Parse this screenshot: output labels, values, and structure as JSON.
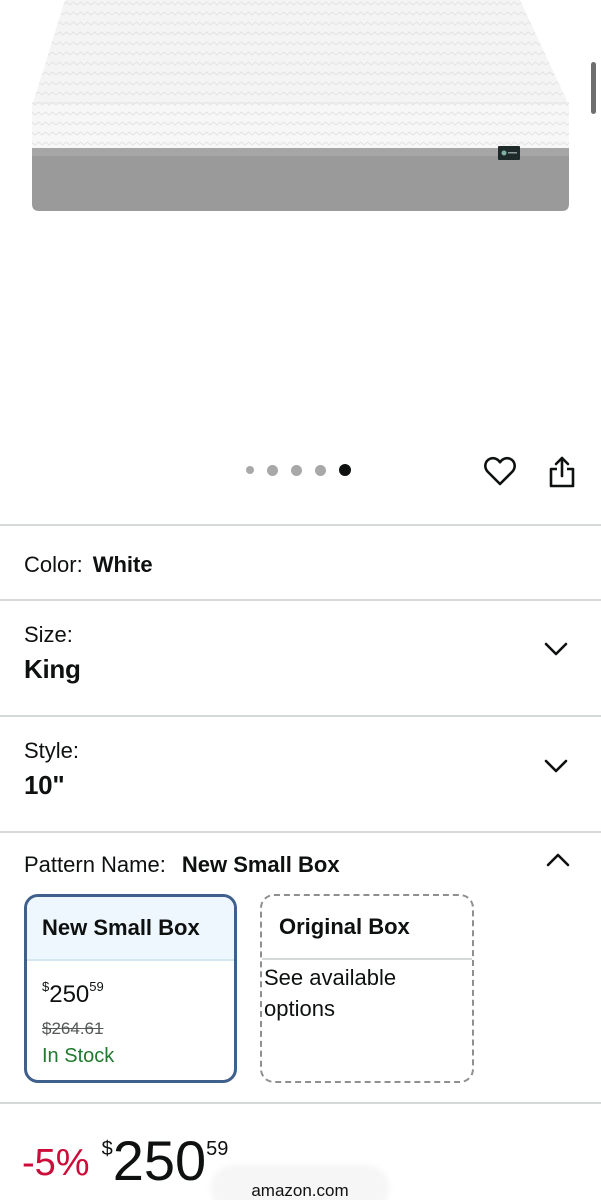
{
  "gallery": {
    "dot_count": 5,
    "active_dot_index": 4,
    "image_alt": "Zinus White Mattress King"
  },
  "variations": {
    "color": {
      "label": "Color:",
      "value": "White"
    },
    "size": {
      "label": "Size:",
      "value": "King"
    },
    "style": {
      "label": "Style:",
      "value": "10\""
    },
    "pattern": {
      "label": "Pattern Name:",
      "value": "New Small Box"
    }
  },
  "pattern_options": [
    {
      "title": "New Small Box",
      "price_symbol": "$",
      "price_whole": "250",
      "price_fraction": "59",
      "list_price": "$264.61",
      "availability": "In Stock",
      "selected": true
    },
    {
      "title": "Original Box",
      "description": "See available options",
      "selected": false
    }
  ],
  "price": {
    "discount": "-5%",
    "symbol": "$",
    "whole": "250",
    "fraction": "59"
  },
  "browser": {
    "domain": "amazon.com"
  },
  "colors": {
    "discount_red": "#cc0c39",
    "in_stock_green": "#1f7a2e",
    "selected_border": "#3f5f8c",
    "selected_header_bg": "#edf7fd"
  },
  "icons": {
    "favorite": "heart-icon",
    "share": "share-icon",
    "expand": "chevron-down-icon",
    "collapse": "chevron-up-icon"
  }
}
